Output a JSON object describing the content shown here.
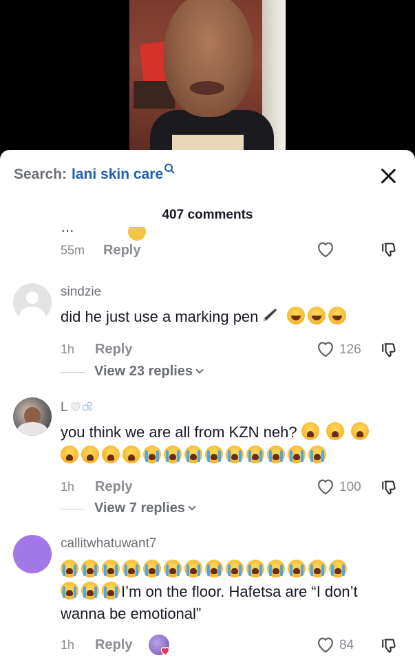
{
  "search": {
    "label": "Search:",
    "term": "lani skin care"
  },
  "header": {
    "comment_count": "407 comments"
  },
  "partial_comment": {
    "text": "…",
    "time": "55m",
    "reply": "Reply"
  },
  "comments": [
    {
      "username": "sindzie",
      "text": "did he just use a marking pen",
      "time": "1h",
      "reply": "Reply",
      "likes": "126",
      "view_replies": "View 23 replies"
    },
    {
      "username": "L",
      "text_line1": "you think we are all from KZN neh?",
      "time": "1h",
      "reply": "Reply",
      "likes": "100",
      "view_replies": "View 7 replies"
    },
    {
      "username": "callitwhatuwant7",
      "text_line2": "I’m on the floor. Hafetsa are “I don’t",
      "text_line3": "wanna be emotional”",
      "time": "1h",
      "reply": "Reply",
      "likes": "84"
    }
  ],
  "icons": {
    "search": "search-icon",
    "close": "close-icon",
    "heart": "heart-outline-icon",
    "dislike": "thumbs-down-icon",
    "chevron": "chevron-down-icon"
  },
  "colors": {
    "search_term": "#1f5fa8",
    "muted": "#8a8b91",
    "text": "#161823",
    "heart_badge": "#e6355a"
  }
}
